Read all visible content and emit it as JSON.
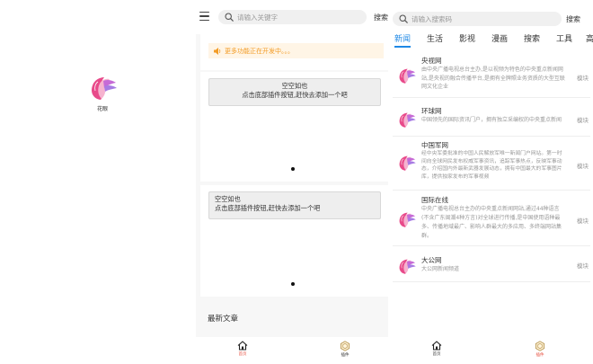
{
  "splash": {
    "app_name": "花眼"
  },
  "home": {
    "search": {
      "placeholder": "请输入关键字",
      "button_label": "搜索"
    },
    "notice": "更多功能正在开发中。。。",
    "plugin_cards": [
      {
        "line1": "空空如也",
        "line2": "点击底部插件按钮,赶快去添加一个吧"
      },
      {
        "line1": "空空如也",
        "line2": "点击底部插件按钮,赶快去添加一个吧"
      }
    ],
    "section_title": "最新文章",
    "nav": [
      {
        "label": "首页",
        "icon": "home-icon",
        "active": true
      },
      {
        "label": "插件",
        "icon": "hexagon-plugin-icon",
        "active": false
      }
    ]
  },
  "plugins": {
    "search": {
      "placeholder": "请输入搜索码",
      "button_label": "搜索"
    },
    "tabs": [
      "新闻",
      "生活",
      "影视",
      "漫画",
      "搜索",
      "工具",
      "高"
    ],
    "active_tab": "新闻",
    "items": [
      {
        "name": "央视网",
        "desc": "由中央广播电视总台主办,是以视频为特色的中央重点新闻网站,是央视的融合传播平台,是拥有全牌照业务资质的大型互联网文化企业",
        "type": "模块"
      },
      {
        "name": "环球网",
        "desc": "中国领先的国际资讯门户，拥有独立采编权的中央重点新闻",
        "type": "模块"
      },
      {
        "name": "中国军网",
        "desc": "经中央军委批准的中国人民解放军唯一新闻门户网站。第一时间向全球网民发布权威军事资讯，追踪军事热点，反映军事动态，介绍国内外最新武器发展动态，拥有中国最大的军事图片库，提供独家发布的军事视频",
        "type": "模块"
      },
      {
        "name": "国际在线",
        "desc": "中央广播电视总台主办的中央重点新闻网站,通过44种语言(不含广东闽潮4种方言)对全球进行传播,是中国使用语种最多、传播地域最广、影响人群最大的多应用、多终端网站集群。",
        "type": "模块"
      },
      {
        "name": "大公网",
        "desc": "大公网新闻频道",
        "type": "模块"
      }
    ],
    "nav": [
      {
        "label": "首页",
        "icon": "home-icon",
        "active": false
      },
      {
        "label": "插件",
        "icon": "hexagon-plugin-icon",
        "active": true
      }
    ]
  },
  "colors": {
    "accent": "#1e88e5",
    "active_nav": "#e74c3c",
    "notice_text": "#f39c26",
    "notice_bg": "#fff5e6",
    "logo_pink": "#e84a8a"
  }
}
